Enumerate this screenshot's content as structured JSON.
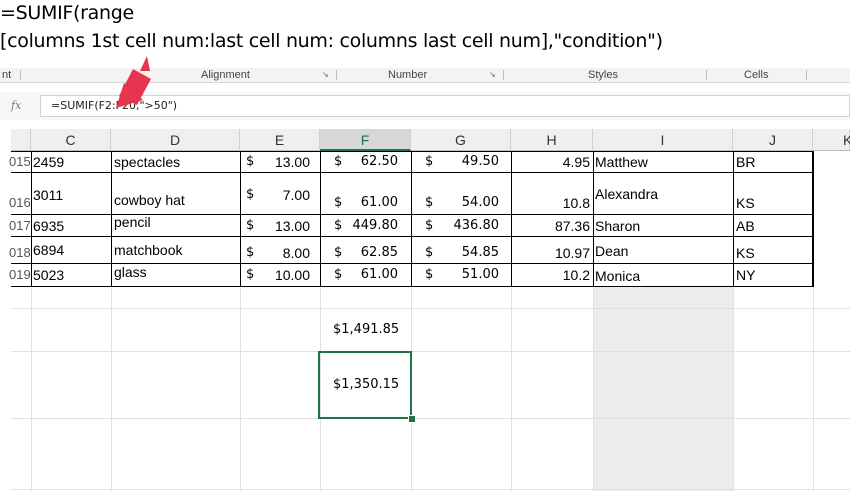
{
  "annotation": {
    "line1": "=SUMIF(range",
    "line2": "[columns 1st cell num:last cell num: columns last cell num],\"condition\")"
  },
  "ribbon": {
    "groups": [
      "nt",
      "Alignment",
      "Number",
      "Styles",
      "Cells"
    ],
    "launcher": "↘"
  },
  "formula_bar": {
    "fx_label": "fx",
    "formula": "=SUMIF(F2:F20,\">50\")"
  },
  "columns": [
    "C",
    "D",
    "E",
    "F",
    "G",
    "H",
    "I",
    "J",
    "K"
  ],
  "selected_column": "F",
  "currency_symbol": "$",
  "rows": [
    {
      "row": "015",
      "c": "2459",
      "d": "spectacles",
      "e": "13.00",
      "f": "62.50",
      "g": "49.50",
      "h": "4.95",
      "i": "Matthew",
      "j": "BR"
    },
    {
      "row": "016",
      "c": "3011",
      "d": "cowboy hat",
      "e": "7.00",
      "f": "61.00",
      "g": "54.00",
      "h": "10.8",
      "i": "Alexandra",
      "j": "KS"
    },
    {
      "row": "017",
      "c": "6935",
      "d": "pencil",
      "e": "13.00",
      "f": "449.80",
      "g": "436.80",
      "h": "87.36",
      "i": "Sharon",
      "j": "AB"
    },
    {
      "row": "018",
      "c": "6894",
      "d": "matchbook",
      "e": "8.00",
      "f": "62.85",
      "g": "54.85",
      "h": "10.97",
      "i": "Dean",
      "j": "KS"
    },
    {
      "row": "019",
      "c": "5023",
      "d": "glass",
      "e": "10.00",
      "f": "61.00",
      "g": "51.00",
      "h": "10.2",
      "i": "Monica",
      "j": "NY"
    }
  ],
  "totals": {
    "sum_all": "$1,491.85",
    "sumif_result": "$1,350.15"
  },
  "colors": {
    "selection": "#217346",
    "arrow": "#e8344e"
  }
}
